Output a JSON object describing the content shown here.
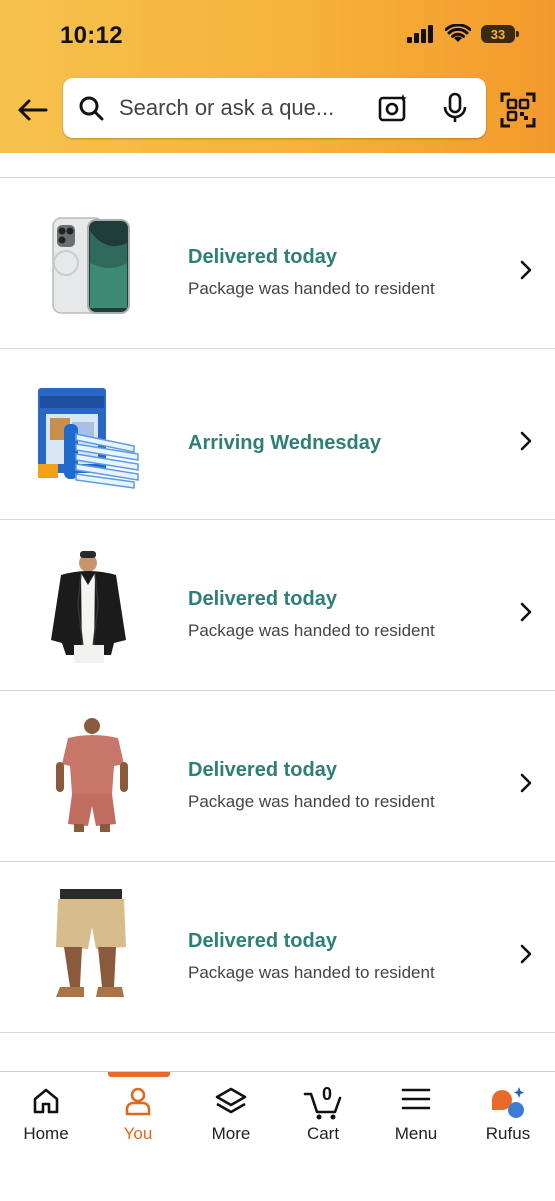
{
  "status_bar": {
    "time": "10:12",
    "battery": "33"
  },
  "search": {
    "placeholder": "Search or ask a que..."
  },
  "orders": [
    {
      "status": "Delivered today",
      "detail": "Package was handed to resident",
      "thumbnail": "phone-case-image"
    },
    {
      "status": "Arriving Wednesday",
      "detail": "",
      "thumbnail": "vacuum-storage-bags-image"
    },
    {
      "status": "Delivered today",
      "detail": "Package was handed to resident",
      "thumbnail": "black-shirt-jacket-image"
    },
    {
      "status": "Delivered today",
      "detail": "Package was handed to resident",
      "thumbnail": "pink-tshirt-shorts-set-image"
    },
    {
      "status": "Delivered today",
      "detail": "Package was handed to resident",
      "thumbnail": "khaki-shorts-image"
    }
  ],
  "nav": {
    "home": "Home",
    "you": "You",
    "more": "More",
    "cart": "Cart",
    "cart_count": "0",
    "menu": "Menu",
    "rufus": "Rufus"
  },
  "colors": {
    "accent": "#e8692a",
    "status_text": "#2e7f76",
    "header_start": "#f6c24d",
    "header_end": "#f39a2c"
  }
}
